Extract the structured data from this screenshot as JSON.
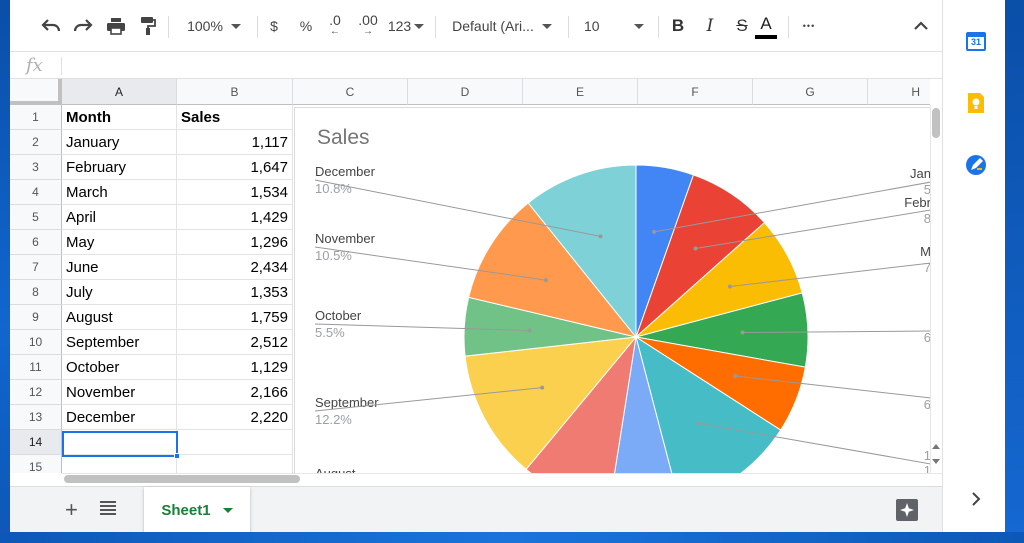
{
  "toolbar": {
    "zoom": "100%",
    "currency": "$",
    "percent": "%",
    "decrease_decimal": ".0",
    "increase_decimal": ".00",
    "more_formats": "123",
    "font": "Default (Ari...",
    "font_size": "10",
    "bold": "B",
    "italic": "I",
    "strikethrough": "S",
    "text_color": "A",
    "more": "•••"
  },
  "formula_bar": {
    "fx_label": "fx",
    "value": ""
  },
  "columns": [
    "A",
    "B",
    "C",
    "D",
    "E",
    "F",
    "G",
    "H"
  ],
  "rows": [
    "1",
    "2",
    "3",
    "4",
    "5",
    "6",
    "7",
    "8",
    "9",
    "10",
    "11",
    "12",
    "13",
    "14",
    "15"
  ],
  "table": {
    "headers": [
      "Month",
      "Sales"
    ],
    "rows": [
      [
        "January",
        "1,117"
      ],
      [
        "February",
        "1,647"
      ],
      [
        "March",
        "1,534"
      ],
      [
        "April",
        "1,429"
      ],
      [
        "May",
        "1,296"
      ],
      [
        "June",
        "2,434"
      ],
      [
        "July",
        "1,353"
      ],
      [
        "August",
        "1,759"
      ],
      [
        "September",
        "2,512"
      ],
      [
        "October",
        "1,129"
      ],
      [
        "November",
        "2,166"
      ],
      [
        "December",
        "2,220"
      ]
    ]
  },
  "chart_data": {
    "type": "pie",
    "title": "Sales",
    "categories": [
      "January",
      "February",
      "March",
      "April",
      "May",
      "June",
      "July",
      "August",
      "September",
      "October",
      "November",
      "December"
    ],
    "values": [
      1117,
      1647,
      1534,
      1429,
      1296,
      2434,
      1353,
      1759,
      2512,
      1129,
      2166,
      2220
    ],
    "colors": [
      "#4285f4",
      "#ea4335",
      "#fbbc04",
      "#34a853",
      "#ff6d01",
      "#46bdc6",
      "#7baaf7",
      "#f07b72",
      "#fcd04f",
      "#71c287",
      "#ff994d",
      "#7ed1d7"
    ],
    "visible_labels": [
      {
        "name": "December",
        "percent": "10.8%"
      },
      {
        "name": "November",
        "percent": "10.5%"
      },
      {
        "name": "October",
        "percent": "5.5%"
      },
      {
        "name": "September",
        "percent": "12.2%"
      }
    ],
    "right_label_fragments": [
      "Jan",
      "5",
      "Febr",
      "8",
      "M",
      "7",
      "6",
      "6",
      "1",
      "1"
    ],
    "bottom_label_fragment": "August",
    "legend": "labels"
  },
  "sheets": {
    "active_name": "Sheet1"
  },
  "side_panel": {
    "calendar_day": "31"
  },
  "colors": {
    "accent_blue": "#1a73e8",
    "sheet_green": "#188038",
    "desktop_blue": "#0b5cc0"
  }
}
